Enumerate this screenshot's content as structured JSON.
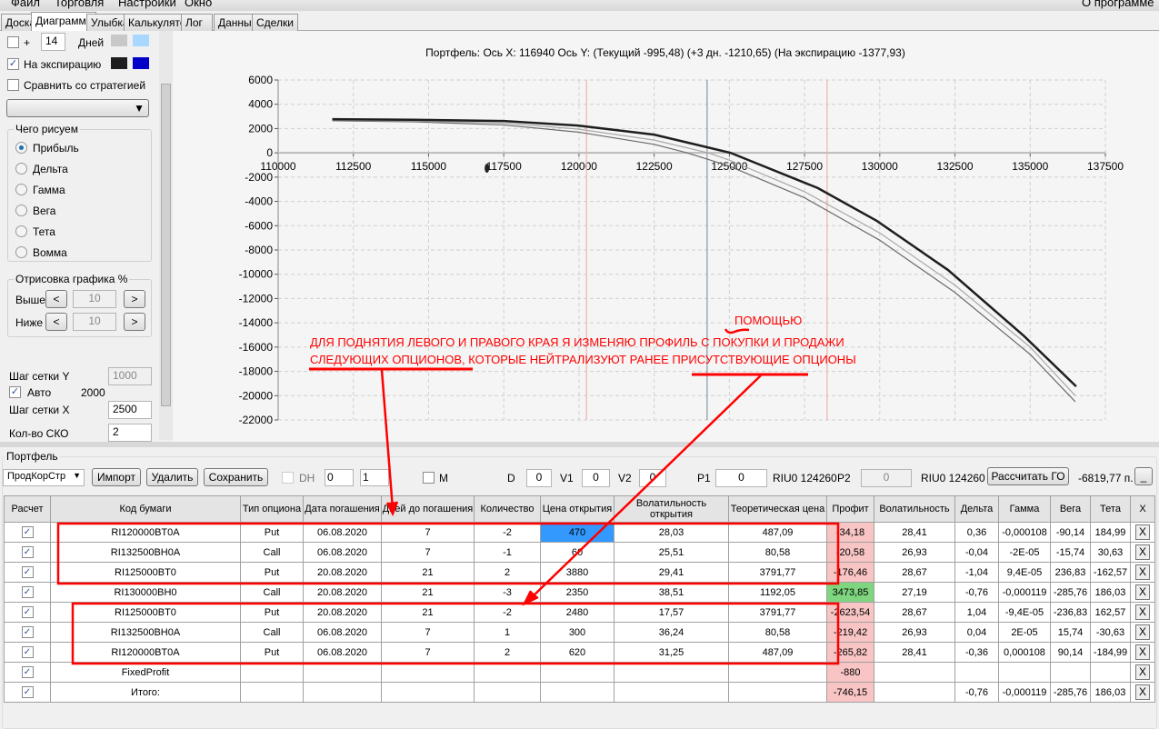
{
  "menu": {
    "items": [
      "Файл",
      "Торговля",
      "Настройки",
      "Окно"
    ],
    "about": "О программе"
  },
  "tabs": [
    "Доска",
    "Диаграмма",
    "Улыбка",
    "Калькулятор",
    "Лог",
    "Данные",
    "Сделки"
  ],
  "left": {
    "plus_label": "+",
    "days_value": "14",
    "days_label": "Дней",
    "days_colors": [
      "#c8c8c8",
      "#a8d8ff"
    ],
    "expiration_label": "На экспирацию",
    "expiration_colors": [
      "#1e1e1e",
      "#0000c8"
    ],
    "compare_label": "Сравнить со стратегией",
    "draw_group": "Чего рисуем",
    "radios": [
      "Прибыль",
      "Дельта",
      "Гамма",
      "Вега",
      "Тета",
      "Вомма"
    ],
    "render_group": "Отрисовка графика %",
    "above_label": "Выше",
    "above_value": "10",
    "below_label": "Ниже",
    "below_value": "10",
    "prev": "<",
    "next": ">",
    "grid_y_label": "Шаг сетки Y",
    "grid_y_value": "1000",
    "auto_label": "Авто",
    "auto_value": "2000",
    "grid_x_label": "Шаг сетки X",
    "grid_x_value": "2500",
    "sko_label": "Кол-во СКО",
    "sko_value": "2"
  },
  "chart_data": {
    "type": "line",
    "title": "Портфель: Ось X: 116940 Ось Y:  (Текущий -995,48)  (+3 дн. -1210,65)  (На экспирацию -1377,93)",
    "xlim": [
      110000,
      137500
    ],
    "ylim": [
      -22000,
      6000
    ],
    "xticks": [
      "110000",
      "112500",
      "115000",
      "117500",
      "120000",
      "122500",
      "125000",
      "127500",
      "130000",
      "132500",
      "135000",
      "137500"
    ],
    "yticks": [
      "6000",
      "4000",
      "2000",
      "0",
      "-2000",
      "-4000",
      "-6000",
      "-8000",
      "-10000",
      "-12000",
      "-14000",
      "-16000",
      "-18000",
      "-20000",
      "-22000"
    ],
    "grid": true,
    "vlines": [
      {
        "x": 120250,
        "color": "#f4b0b0"
      },
      {
        "x": 124260,
        "color": "#8a96a4"
      },
      {
        "x": 128250,
        "color": "#f4b0b0"
      }
    ],
    "series": [
      {
        "color": "#6a6a6a",
        "points": [
          [
            111800,
            2650
          ],
          [
            114500,
            2550
          ],
          [
            117500,
            2300
          ],
          [
            120000,
            1700
          ],
          [
            122500,
            700
          ],
          [
            123600,
            0
          ],
          [
            125000,
            -1100
          ],
          [
            127500,
            -3700
          ],
          [
            130000,
            -7200
          ],
          [
            132500,
            -11500
          ],
          [
            135000,
            -16600
          ],
          [
            136500,
            -20500
          ]
        ]
      },
      {
        "color": "#a8a8a8",
        "points": [
          [
            111800,
            2700
          ],
          [
            114500,
            2620
          ],
          [
            117500,
            2450
          ],
          [
            120000,
            1950
          ],
          [
            122500,
            1050
          ],
          [
            124300,
            0
          ],
          [
            125000,
            -600
          ],
          [
            127500,
            -3200
          ],
          [
            130000,
            -6600
          ],
          [
            132500,
            -10900
          ],
          [
            135000,
            -16000
          ],
          [
            136500,
            -20000
          ]
        ]
      },
      {
        "color": "#1e1e1e",
        "points": [
          [
            111800,
            2770
          ],
          [
            114500,
            2720
          ],
          [
            117500,
            2620
          ],
          [
            120000,
            2240
          ],
          [
            122500,
            1500
          ],
          [
            125040,
            0
          ],
          [
            127940,
            -2900
          ],
          [
            129900,
            -5600
          ],
          [
            132270,
            -9650
          ],
          [
            134800,
            -15100
          ],
          [
            136530,
            -19240
          ]
        ]
      }
    ]
  },
  "annotation": {
    "line1": "ДЛЯ ПОДНЯТИЯ ЛЕВОГО И ПРАВОГО КРАЯ Я ИЗМЕНЯЮ ПРОФИЛЬ С ПОКУПКИ И ПРОДАЖИ",
    "line2": "СЛЕДУЮЩИХ ОПЦИОНОВ, КОТОРЫЕ НЕЙТРАЛИЗУЮТ РАНЕЕ ПРИСУТСТВУЮЩИЕ ОПЦИОНЫ",
    "insert": "ПОМОЩЬЮ",
    "color": "#ff0000"
  },
  "portfolio": {
    "group": "Портфель",
    "select": "ПродКорСтр",
    "import": "Импорт",
    "delete": "Удалить",
    "save": "Сохранить",
    "dh": "DH",
    "spin1": "0",
    "spin2": "1",
    "m": "M",
    "d_label": "D",
    "d": "0",
    "v1_label": "V1",
    "v1": "0",
    "v2_label": "V2",
    "v2": "0",
    "p1_label": "P1",
    "p1": "0",
    "riu1": "RIU0 124260",
    "p2_label": "P2",
    "p2": "0",
    "riu2": "RIU0 124260",
    "calc_go": "Рассчитать ГО",
    "go_value": "-6819,77 п.",
    "min_btn": "_"
  },
  "table": {
    "headers": [
      "Расчет",
      "Код бумаги",
      "Тип опциона",
      "Дата погашения",
      "Дней до погашения",
      "Количество",
      "Цена открытия",
      "Волатильность открытия",
      "Теоретическая цена",
      "Профит",
      "Волатильность",
      "Дельта",
      "Гамма",
      "Вега",
      "Тета",
      "X"
    ],
    "rows": [
      [
        "✓",
        "RI120000BT0A",
        "Put",
        "06.08.2020",
        "7",
        "-2",
        "470",
        "28,03",
        "487,09",
        "-34,18",
        "28,41",
        "0,36",
        "-0,000108",
        "-90,14",
        "184,99",
        "X"
      ],
      [
        "✓",
        "RI132500BH0A",
        "Call",
        "06.08.2020",
        "7",
        "-1",
        "60",
        "25,51",
        "80,58",
        "-20,58",
        "26,93",
        "-0,04",
        "-2E-05",
        "-15,74",
        "30,63",
        "X"
      ],
      [
        "✓",
        "RI125000BT0",
        "Put",
        "20.08.2020",
        "21",
        "2",
        "3880",
        "29,41",
        "3791,77",
        "-176,46",
        "28,67",
        "-1,04",
        "9,4E-05",
        "236,83",
        "-162,57",
        "X"
      ],
      [
        "✓",
        "RI130000BH0",
        "Call",
        "20.08.2020",
        "21",
        "-3",
        "2350",
        "38,51",
        "1192,05",
        "3473,85",
        "27,19",
        "-0,76",
        "-0,000119",
        "-285,76",
        "186,03",
        "X"
      ],
      [
        "✓",
        "RI125000BT0",
        "Put",
        "20.08.2020",
        "21",
        "-2",
        "2480",
        "17,57",
        "3791,77",
        "-2623,54",
        "28,67",
        "1,04",
        "-9,4E-05",
        "-236,83",
        "162,57",
        "X"
      ],
      [
        "✓",
        "RI132500BH0A",
        "Call",
        "06.08.2020",
        "7",
        "1",
        "300",
        "36,24",
        "80,58",
        "-219,42",
        "26,93",
        "0,04",
        "2E-05",
        "15,74",
        "-30,63",
        "X"
      ],
      [
        "✓",
        "RI120000BT0A",
        "Put",
        "06.08.2020",
        "7",
        "2",
        "620",
        "31,25",
        "487,09",
        "-265,82",
        "28,41",
        "-0,36",
        "0,000108",
        "90,14",
        "-184,99",
        "X"
      ],
      [
        "✓",
        "FixedProfit",
        "",
        "",
        "",
        "",
        "",
        "",
        "",
        "-880",
        "",
        "",
        "",
        "",
        "",
        "X"
      ],
      [
        "✓",
        "Итого:",
        "",
        "",
        "",
        "",
        "",
        "",
        "",
        "-746,15",
        "",
        "-0,76",
        "-0,000119",
        "-285,76",
        "186,03",
        "X"
      ]
    ],
    "profit_status": [
      "pink",
      "pink",
      "pink",
      "green",
      "pink",
      "pink",
      "pink",
      "pink",
      "pink"
    ],
    "selected_cell": "0.6"
  }
}
